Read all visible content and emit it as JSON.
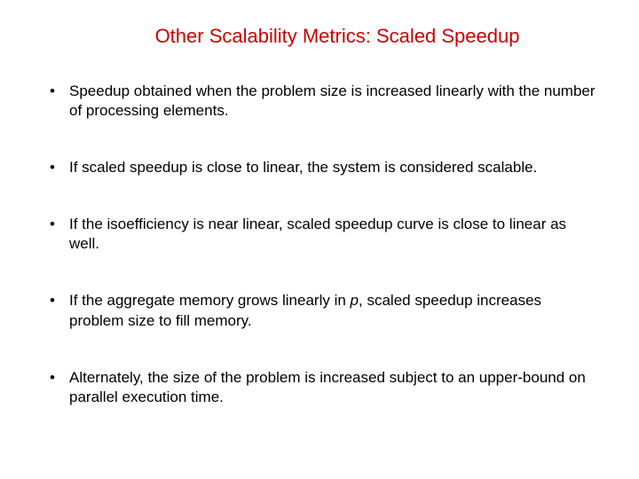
{
  "title": "Other Scalability Metrics: Scaled Speedup",
  "bullets": [
    {
      "text": "Speedup obtained when the problem size is increased linearly with the number of processing elements."
    },
    {
      "text": "If scaled speedup is close to linear, the system is considered scalable."
    },
    {
      "text": "If the isoefficiency is near linear, scaled speedup curve is close to linear as well."
    },
    {
      "pre": "If the aggregate memory grows linearly in ",
      "em": "p",
      "post": ", scaled speedup increases problem size to fill memory."
    },
    {
      "text": "Alternately, the size of the problem is increased subject to an upper-bound on parallel execution time."
    }
  ]
}
